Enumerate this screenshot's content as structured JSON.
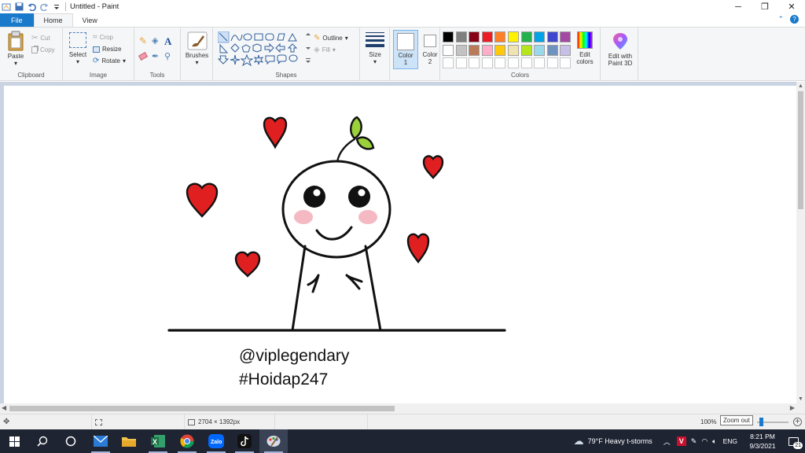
{
  "window": {
    "title": "Untitled - Paint",
    "minimize": "─",
    "maximize": "❐",
    "close": "✕"
  },
  "tabs": {
    "file": "File",
    "home": "Home",
    "view": "View",
    "chevron": "⌃",
    "help": "?"
  },
  "ribbon": {
    "clipboard": {
      "label": "Clipboard",
      "paste": "Paste",
      "cut": "Cut",
      "copy": "Copy"
    },
    "image": {
      "label": "Image",
      "select": "Select",
      "crop": "Crop",
      "resize": "Resize",
      "rotate": "Rotate"
    },
    "tools": {
      "label": "Tools"
    },
    "brushes": {
      "label": "Brushes"
    },
    "shapes": {
      "label": "Shapes",
      "outline": "Outline",
      "fill": "Fill"
    },
    "size": {
      "label": "Size"
    },
    "color1": {
      "label": "Color",
      "number": "1"
    },
    "color2": {
      "label": "Color",
      "number": "2"
    },
    "colors": {
      "label": "Colors",
      "edit_colors": "Edit",
      "edit_colors_2": "colors"
    },
    "paint3d": {
      "label": "Edit with",
      "label_2": "Paint 3D"
    }
  },
  "palette": {
    "row1": [
      "#000000",
      "#7f7f7f",
      "#880015",
      "#ed1c24",
      "#ff7f27",
      "#fff200",
      "#22b14c",
      "#00a2e8",
      "#3f48cc",
      "#a349a4"
    ],
    "row2": [
      "#ffffff",
      "#c3c3c3",
      "#b97a57",
      "#ffaec9",
      "#ffc90e",
      "#efe4b0",
      "#b5e61d",
      "#99d9ea",
      "#7092be",
      "#c8bfe7"
    ],
    "row3": [
      "#ffffff",
      "#ffffff",
      "#ffffff",
      "#ffffff",
      "#ffffff",
      "#ffffff",
      "#ffffff",
      "#ffffff",
      "#ffffff",
      "#ffffff"
    ]
  },
  "drawing": {
    "text_line_1": "@viplegendary",
    "text_line_2": "#Hoidap247",
    "heart_color": "#e02020",
    "leaf_color": "#9ad03a"
  },
  "status": {
    "dimensions": "2704 × 1392px",
    "zoom": "100%",
    "zoom_tooltip": "Zoom out"
  },
  "taskbar": {
    "weather": "79°F  Heavy t-storms",
    "language": "ENG",
    "time": "8:21 PM",
    "date": "9/3/2021",
    "notifications": "21"
  }
}
